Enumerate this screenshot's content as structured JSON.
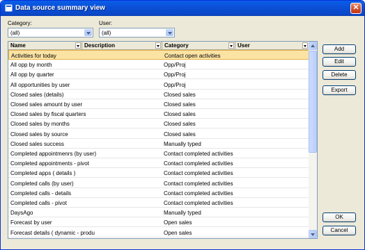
{
  "window": {
    "title": "Data source summary view"
  },
  "filters": {
    "category_label": "Category:",
    "category_value": "(all)",
    "user_label": "User:",
    "user_value": "(all)"
  },
  "grid": {
    "columns": [
      "Name",
      "Description",
      "Category",
      "User"
    ],
    "rows": [
      {
        "name": "Activities for today",
        "category": "Contact open activities",
        "selected": true
      },
      {
        "name": "All opp by month",
        "category": "Opp/Proj"
      },
      {
        "name": "All opp by quarter",
        "category": "Opp/Proj"
      },
      {
        "name": "All opportunities by user",
        "category": "Opp/Proj"
      },
      {
        "name": "Closed sales (details)",
        "category": "Closed sales"
      },
      {
        "name": "Closed sales amount by user",
        "category": "Closed sales"
      },
      {
        "name": "Closed sales by fiscal quarters",
        "category": "Closed sales"
      },
      {
        "name": "Closed sales by months",
        "category": "Closed sales"
      },
      {
        "name": "Closed sales by source",
        "category": "Closed sales"
      },
      {
        "name": "Closed sales success",
        "category": "Manually typed"
      },
      {
        "name": "Completed appointmenrs (by user)",
        "category": "Contact completed activities"
      },
      {
        "name": "Completed appointments - pivot",
        "category": "Contact completed activities"
      },
      {
        "name": "Completed apps ( details )",
        "category": "Contact completed activities"
      },
      {
        "name": "Completed calls (by user)",
        "category": "Contact completed activities"
      },
      {
        "name": "Completed calls - details",
        "category": "Contact completed activities"
      },
      {
        "name": "Completed calls - pivot",
        "category": "Contact completed activities"
      },
      {
        "name": "DaysAgo",
        "category": "Manually typed"
      },
      {
        "name": "Forecast by user",
        "category": "Open sales"
      },
      {
        "name": "Forecast details ( dynamic - produ",
        "category": "Open sales"
      }
    ]
  },
  "buttons": {
    "add": "Add",
    "edit": "Edit",
    "delete": "Delete",
    "export": "Export",
    "ok": "OK",
    "cancel": "Cancel"
  },
  "icons": {
    "close": "close-icon",
    "app": "window-icon"
  }
}
